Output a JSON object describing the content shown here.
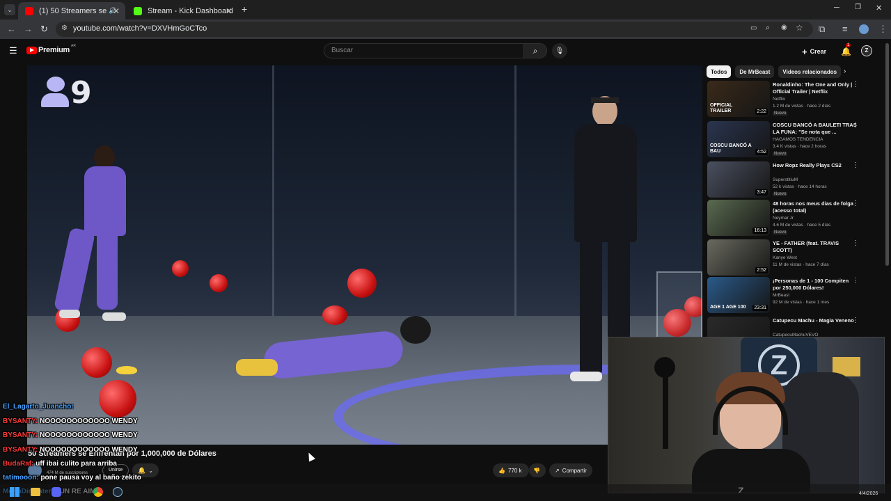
{
  "browser": {
    "tabs": [
      {
        "label": "(1) 50 Streamers se Enfrentá",
        "active": true
      },
      {
        "label": "Stream - Kick Dashboard",
        "active": false
      }
    ],
    "url": "youtube.com/watch?v=DXVHmGoCTco"
  },
  "youtube": {
    "logo_text": "Premium",
    "region": "AR",
    "search_placeholder": "Buscar",
    "create_label": "Crear",
    "notif_count": "1"
  },
  "video": {
    "counter": "9",
    "title": "50 Streamers se Enfrentan por 1,000,000 de Dólares",
    "subscribers": "474 M de suscriptores",
    "join_label": "Unirse",
    "likes": "770 k",
    "share_label": "Compartir"
  },
  "sidebar": {
    "chips": [
      "Todos",
      "De MrBeast",
      "Videos relacionados"
    ],
    "items": [
      {
        "title": "Ronaldinho: The One and Only | Official Trailer | Netflix",
        "channel": "Netflix",
        "meta": "1.2 M de vistas · hace 2 días",
        "badge": "Nuevo",
        "duration": "2:22",
        "thumb_text": "OFFICIAL TRAILER",
        "thumb_color": "#3a2a1a"
      },
      {
        "title": "COSCU BANCÓ A BAULETI TRAS LA FUNA: \"Se nota que ...",
        "channel": "HAGAMOS TENDENCIA",
        "meta": "3.4 K vistas · hace 2 horas",
        "badge": "Nuevo",
        "duration": "4:52",
        "thumb_text": "COSCU BANCÓ A BAU",
        "thumb_color": "#2a3550"
      },
      {
        "title": "How Ropz Really Plays CS2",
        "channel": "SuperstitiuM",
        "meta": "52 k vistas · hace 14 horas",
        "badge": "Nuevo",
        "duration": "3:47",
        "thumb_text": "",
        "thumb_color": "#4a5060"
      },
      {
        "title": "48 horas nos meus dias de folga (acesso total)",
        "channel": "Neymar Jr",
        "meta": "4.6 M de vistas · hace 5 días",
        "badge": "Nuevo",
        "duration": "16:13",
        "thumb_text": "",
        "thumb_color": "#5a6a50"
      },
      {
        "title": "YE - FATHER (feat. TRAVIS SCOTT)",
        "channel": "Kanye West",
        "meta": "11 M de vistas · hace 7 días",
        "badge": "",
        "duration": "2:52",
        "thumb_text": "",
        "thumb_color": "#6a6a60"
      },
      {
        "title": "¡Personas de 1 - 100 Compiten por 250,000 Dólares!",
        "channel": "MrBeast",
        "meta": "92 M de vistas · hace 1 mes",
        "badge": "",
        "duration": "23:31",
        "thumb_text": "AGE 1   AGE 100",
        "thumb_color": "#2a5a8a"
      },
      {
        "title": "Catupecu Machu - Magia Veneno",
        "channel": "CatupecuMachuVEVO",
        "meta": "",
        "badge": "",
        "duration": "",
        "thumb_text": "",
        "thumb_color": "#2a2a2a"
      }
    ]
  },
  "chat": [
    {
      "user": "El_Lagarto_Juancho:",
      "msg": "",
      "color": "#4aa3ff"
    },
    {
      "user": "BYSANTY:",
      "msg": "NOOOOOOOOOOOO WENDY",
      "color": "#ff3b3b"
    },
    {
      "user": "BYSANTY:",
      "msg": "NOOOOOOOOOOOO WENDY",
      "color": "#ff3b3b"
    },
    {
      "user": "BYSANTY:",
      "msg": "NOOOOOOOOOOOO WENDY",
      "color": "#ff3b3b"
    },
    {
      "user": "BudaRaf:",
      "msg": "uff ibai culito para arriba",
      "color": "#ff3b3b"
    },
    {
      "user": "tatimooon:",
      "msg": "pone pausa voy al baño zekito",
      "color": "#4aa3ff"
    },
    {
      "user": "MonoDimastero:",
      "msg": "UN RE AIM",
      "color": "#4aa3ff"
    }
  ],
  "taskbar": {
    "date": "4/4/2026"
  },
  "colors": {
    "accent_red": "#ff0000",
    "chip_bg": "#272727",
    "bg": "#0f0f0f"
  }
}
